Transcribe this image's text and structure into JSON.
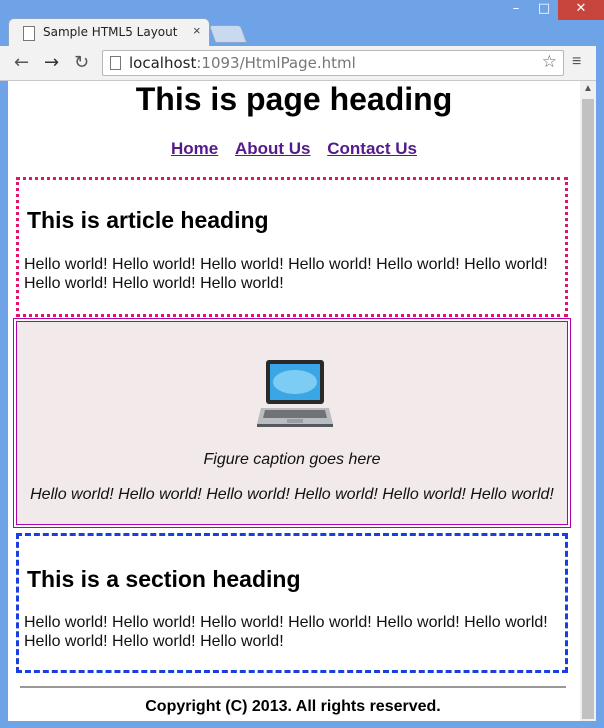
{
  "browser": {
    "tab_title": "Sample HTML5 Layout",
    "tab_close": "×",
    "window_buttons": {
      "minimize": "–",
      "maximize": "□",
      "close": "✕"
    },
    "nav": {
      "back": "←",
      "forward": "→",
      "reload": "↻"
    },
    "url_host": "localhost",
    "url_rest": ":1093/HtmlPage.html",
    "bookmark_star": "☆",
    "menu": "≡"
  },
  "page": {
    "heading": "This is page heading",
    "nav_links": [
      "Home",
      "About Us",
      "Contact Us"
    ],
    "article": {
      "heading": "This is article heading",
      "text": "Hello world! Hello world! Hello world! Hello world! Hello world! Hello world! Hello world! Hello world! Hello world!"
    },
    "figure": {
      "caption": "Figure caption goes here",
      "text": "Hello world! Hello world! Hello world! Hello world! Hello world! Hello world!"
    },
    "section": {
      "heading": "This is a section heading",
      "text": "Hello world! Hello world! Hello world! Hello world! Hello world! Hello world! Hello world! Hello world! Hello world!"
    },
    "footer": "Copyright (C) 2013. All rights reserved."
  },
  "colors": {
    "article_border": "#e0156b",
    "section_border": "#1a3ee0",
    "figure_border": "#b000b0",
    "figure_bg": "#f2eaea",
    "link": "#551a8b"
  }
}
